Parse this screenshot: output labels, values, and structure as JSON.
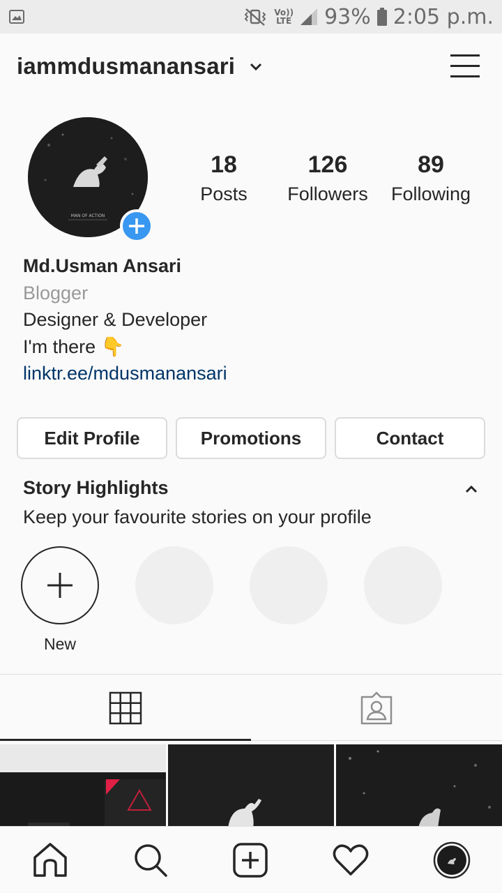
{
  "status_bar": {
    "battery": "93%",
    "time": "2:05 p.m.",
    "volte_top": "Vo))",
    "volte_bottom": "LTE"
  },
  "header": {
    "username": "iammdusmanansari"
  },
  "profile": {
    "avatar_caption": "MAN OF ACTION",
    "stats": [
      {
        "value": "18",
        "label": "Posts"
      },
      {
        "value": "126",
        "label": "Followers"
      },
      {
        "value": "89",
        "label": "Following"
      }
    ],
    "name": "Md.Usman Ansari",
    "category": "Blogger",
    "bio_line1": "Designer & Developer",
    "bio_line2": "I'm there 👇",
    "link": "linktr.ee/mdusmanansari"
  },
  "actions": {
    "edit_profile": "Edit Profile",
    "promotions": "Promotions",
    "contact": "Contact"
  },
  "highlights": {
    "title": "Story Highlights",
    "subtitle": "Keep your favourite stories on your profile",
    "new_label": "New"
  },
  "colors": {
    "accent": "#3897f0",
    "link": "#003569",
    "muted": "#999999"
  }
}
